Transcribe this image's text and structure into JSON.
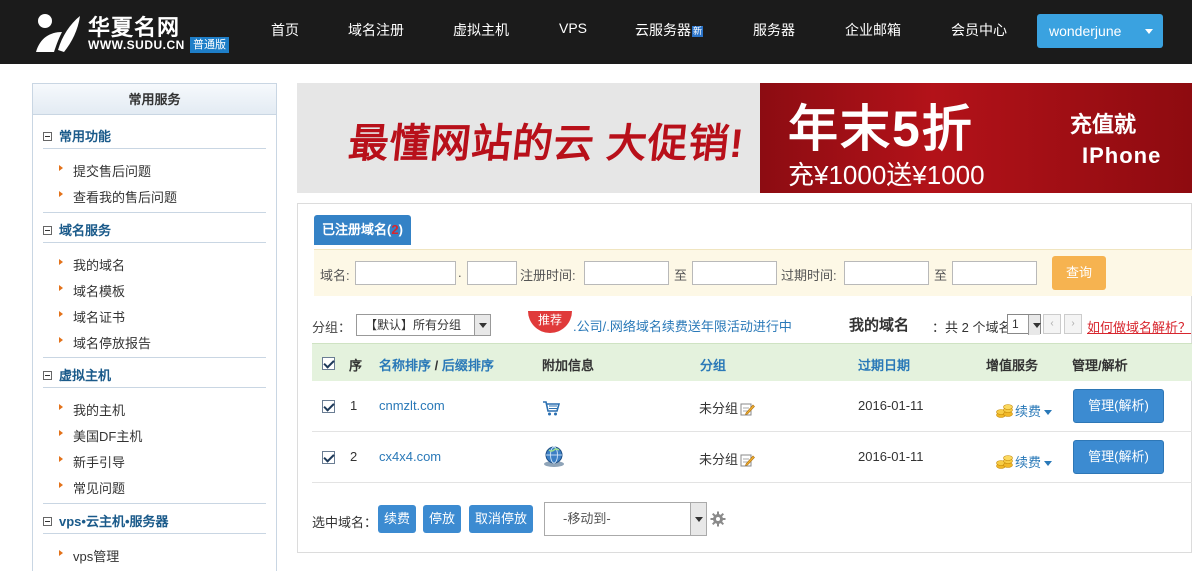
{
  "header": {
    "logo_title": "华夏名网",
    "logo_url": "WWW.SUDU.CN",
    "logo_badge": "普通版",
    "nav": [
      "首页",
      "域名注册",
      "虚拟主机",
      "VPS",
      "云服务器",
      "服务器",
      "企业邮箱",
      "会员中心"
    ],
    "nav_new_tag": "新",
    "user": "wonderjune"
  },
  "sidebar": {
    "title": "常用服务",
    "sections": [
      {
        "title": "常用功能",
        "items": [
          "提交售后问题",
          "查看我的售后问题"
        ]
      },
      {
        "title": "域名服务",
        "items": [
          "我的域名",
          "域名模板",
          "域名证书",
          "域名停放报告"
        ]
      },
      {
        "title": "虚拟主机",
        "items": [
          "我的主机",
          "美国DF主机",
          "新手引导",
          "常见问题"
        ]
      },
      {
        "title": "vps•云主机•服务器",
        "items": [
          "vps管理"
        ]
      }
    ]
  },
  "banner": {
    "slogan": "最懂网站的云 大促销!",
    "big": "年末5折",
    "sub": "充¥1000送¥1000",
    "side1": "充值就",
    "side2": "IPhone"
  },
  "panel": {
    "tab_label": "已注册域名(",
    "tab_count": "2",
    "tab_close": ")",
    "search": {
      "domain_label": "域名:",
      "dot": ".",
      "reg_time_label": "注册时间:",
      "to1": "至",
      "expire_label": "过期时间:",
      "to2": "至",
      "query_btn": "查询"
    },
    "toolbar": {
      "group_label": "分组：",
      "group_value": "【默认】所有分组",
      "promo_badge": "推荐",
      "promo_text": ".公司/.网络域名续费送年限活动进行中",
      "my_domains": "我的域名",
      "count_text": "：共 2 个域名",
      "page_value": "1",
      "help_link": "如何做域名解析？"
    },
    "table": {
      "headers": {
        "seq": "序",
        "sort_name": "名称排序",
        "slash": "/",
        "sort_suffix": "后缀排序",
        "extra": "附加信息",
        "group": "分组",
        "expire": "过期日期",
        "value_add": "增值服务",
        "manage": "管理/解析"
      },
      "rows": [
        {
          "seq": "1",
          "domain": "cnmzlt.com",
          "group": "未分组",
          "expire": "2016-01-11",
          "service": "续费",
          "manage": "管理(解析)"
        },
        {
          "seq": "2",
          "domain": "cx4x4.com",
          "group": "未分组",
          "expire": "2016-01-11",
          "service": "续费",
          "manage": "管理(解析)"
        }
      ]
    },
    "bottom": {
      "selected_label": "选中域名：",
      "btn_renew": "续费",
      "btn_park": "停放",
      "btn_unpark": "取消停放",
      "move_to": "-移动到-"
    }
  },
  "colors": {
    "topbar": "#1b1b1b",
    "accent_blue": "#3482c6",
    "user_button": "#3aa2e0",
    "query_button": "#f6b350",
    "table_header": "#e4f2dd",
    "link": "#2a79b8",
    "alert_red": "#d7262e"
  }
}
